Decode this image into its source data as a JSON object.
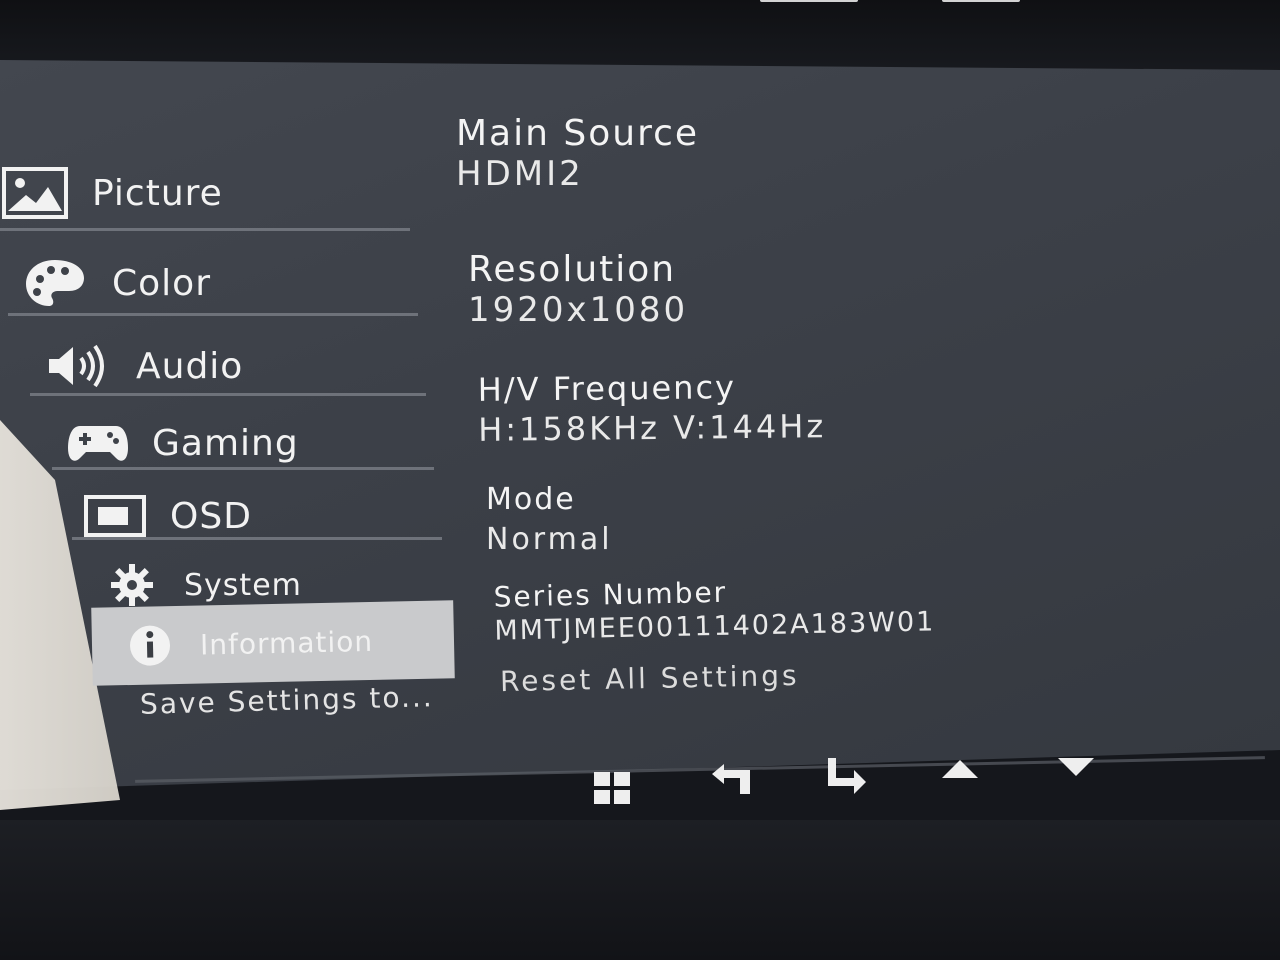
{
  "menu": {
    "items": [
      {
        "label": "Picture",
        "icon": "picture-icon"
      },
      {
        "label": "Color",
        "icon": "palette-icon"
      },
      {
        "label": "Audio",
        "icon": "speaker-icon"
      },
      {
        "label": "Gaming",
        "icon": "gamepad-icon"
      },
      {
        "label": "OSD",
        "icon": "osd-icon"
      },
      {
        "label": "System",
        "icon": "gear-icon"
      },
      {
        "label": "Information",
        "icon": "info-icon"
      }
    ],
    "selected": "Information",
    "save_settings": "Save Settings to..."
  },
  "info": {
    "main_source_label": "Main Source",
    "main_source_value": "HDMI2",
    "resolution_label": "Resolution",
    "resolution_value": "1920x1080",
    "frequency_label": "H/V Frequency",
    "frequency_value": "H:158KHz V:144Hz",
    "mode_label": "Mode",
    "mode_value": "Normal",
    "serial_label": "Series Number",
    "serial_value": "MMTJMEE00111402A183W01",
    "reset_label": "Reset All Settings"
  },
  "nav_buttons": [
    {
      "icon": "menu-grid-icon"
    },
    {
      "icon": "back-arrow-icon"
    },
    {
      "icon": "enter-arrow-icon"
    },
    {
      "icon": "up-triangle-icon"
    },
    {
      "icon": "down-triangle-icon"
    }
  ],
  "colors": {
    "panel_bg": "#3e4249",
    "selected_bg": "#c9cacc",
    "text": "#f2f2f2"
  }
}
